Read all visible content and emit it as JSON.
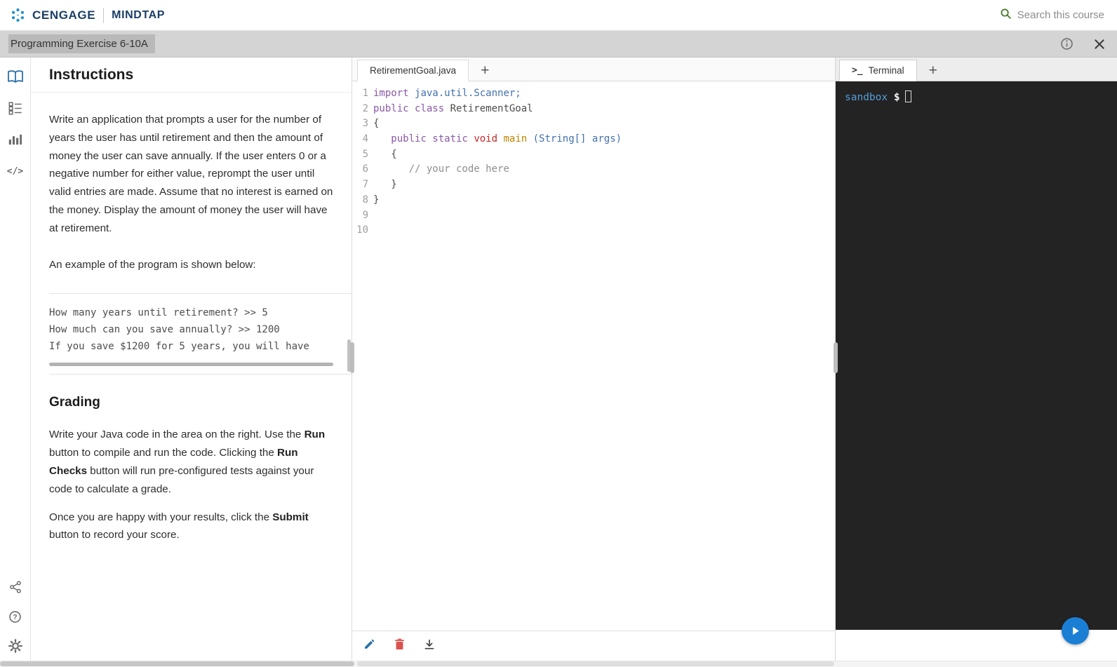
{
  "header": {
    "brand": "CENGAGE",
    "product": "MINDTAP",
    "search_label": "Search this course"
  },
  "titlebar": {
    "title": "Programming Exercise 6-10A",
    "icons": [
      "info-icon",
      "close-icon"
    ]
  },
  "sidebar": {
    "top_icons": [
      "open-book-icon",
      "checklist-icon",
      "bar-chart-icon",
      "code-icon"
    ],
    "bottom_icons": [
      "share-icon",
      "help-icon",
      "gear-icon"
    ]
  },
  "instructions": {
    "heading": "Instructions",
    "body_paragraph": "Write an application that prompts a user for the number of years the user has until retirement and then the amount of money the user can save annually. If the user enters 0 or a negative number for either value, reprompt the user until valid entries are made. Assume that no interest is earned on the money. Display the amount of money the user will have at retirement.",
    "example_intro": "An example of the program is shown below:",
    "example_lines": [
      "How many years until retirement? >> 5",
      "How much can you save annually? >> 1200",
      "If you save $1200 for 5 years, you will have"
    ],
    "grading": {
      "heading": "Grading",
      "p1": [
        "Write your Java code in the area on the right. Use the ",
        "Run",
        " button to compile and run the code. Clicking the ",
        "Run Checks",
        " button will run pre-configured tests against your code to calculate a grade."
      ],
      "p2": [
        "Once you are happy with your results, click the ",
        "Submit",
        " button to record your score."
      ]
    }
  },
  "editor": {
    "tab_label": "RetirementGoal.java",
    "new_tab_label": "+",
    "toolbar_icons": [
      "edit-pencil-icon",
      "delete-trash-icon",
      "download-icon"
    ],
    "code_lines": [
      {
        "num": "1",
        "tokens": [
          [
            "kw",
            "import"
          ],
          [
            "pl",
            " "
          ],
          [
            "qual",
            "java.util.Scanner;"
          ]
        ]
      },
      {
        "num": "2",
        "tokens": [
          [
            "kw",
            "public class"
          ],
          [
            "pl",
            " RetirementGoal"
          ]
        ]
      },
      {
        "num": "3",
        "tokens": [
          [
            "pl",
            "{"
          ]
        ]
      },
      {
        "num": "4",
        "tokens": [
          [
            "pl",
            "   "
          ],
          [
            "kw",
            "public static"
          ],
          [
            "pl",
            " "
          ],
          [
            "type",
            "void"
          ],
          [
            "pl",
            " "
          ],
          [
            "fn",
            "main"
          ],
          [
            "pl",
            " "
          ],
          [
            "paren",
            "(String[] args)"
          ]
        ]
      },
      {
        "num": "5",
        "tokens": [
          [
            "pl",
            "   {"
          ]
        ]
      },
      {
        "num": "6",
        "tokens": [
          [
            "pl",
            "      "
          ],
          [
            "cm",
            "// your code here"
          ]
        ]
      },
      {
        "num": "7",
        "tokens": [
          [
            "pl",
            "   }"
          ]
        ]
      },
      {
        "num": "8",
        "tokens": [
          [
            "pl",
            "}"
          ]
        ]
      },
      {
        "num": "9",
        "tokens": []
      },
      {
        "num": "10",
        "tokens": []
      }
    ]
  },
  "terminal": {
    "tab_label": "Terminal",
    "new_tab_label": "+",
    "prompt_host": "sandbox",
    "prompt_symbol": "$"
  },
  "colors": {
    "brand_navy": "#1b3f67",
    "logo_blue": "#1f8fce",
    "search_green": "#4a7d2c",
    "titlebar_gray": "#d4d4d4",
    "title_highlight": "#b9b9b9",
    "active_rail_blue": "#2d71a9",
    "keyword_purple": "#8959a8",
    "type_red": "#c82829",
    "function_gold": "#c18401",
    "identifier_blue": "#4271ae",
    "comment_gray": "#8e908c",
    "terminal_bg": "#232323",
    "terminal_host_blue": "#569cd6",
    "play_button_blue": "#1a7fd4",
    "trash_red": "#d9534f",
    "pencil_blue": "#2d71a9"
  }
}
